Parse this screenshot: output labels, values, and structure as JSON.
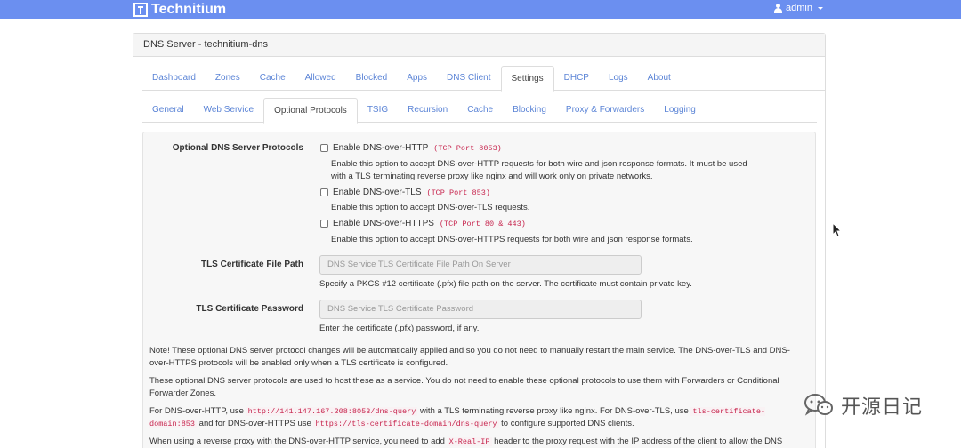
{
  "brand": {
    "name": "Technitium"
  },
  "user": {
    "name": "admin"
  },
  "panel": {
    "title": "DNS Server - technitium-dns"
  },
  "main_tabs": [
    {
      "label": "Dashboard"
    },
    {
      "label": "Zones"
    },
    {
      "label": "Cache"
    },
    {
      "label": "Allowed"
    },
    {
      "label": "Blocked"
    },
    {
      "label": "Apps"
    },
    {
      "label": "DNS Client"
    },
    {
      "label": "Settings"
    },
    {
      "label": "DHCP"
    },
    {
      "label": "Logs"
    },
    {
      "label": "About"
    }
  ],
  "main_tabs_active": "Settings",
  "sub_tabs": [
    {
      "label": "General"
    },
    {
      "label": "Web Service"
    },
    {
      "label": "Optional Protocols"
    },
    {
      "label": "TSIG"
    },
    {
      "label": "Recursion"
    },
    {
      "label": "Cache"
    },
    {
      "label": "Blocking"
    },
    {
      "label": "Proxy & Forwarders"
    },
    {
      "label": "Logging"
    }
  ],
  "sub_tabs_active": "Optional Protocols",
  "protocols": {
    "label": "Optional DNS Server Protocols",
    "http": {
      "label": "Enable DNS-over-HTTP",
      "port": "(TCP Port 8053)",
      "checked": false,
      "help": "Enable this option to accept DNS-over-HTTP requests for both wire and json response formats. It must be used with a TLS terminating reverse proxy like nginx and will work only on private networks."
    },
    "tls": {
      "label": "Enable DNS-over-TLS",
      "port": "(TCP Port 853)",
      "checked": false,
      "help": "Enable this option to accept DNS-over-TLS requests."
    },
    "https": {
      "label": "Enable DNS-over-HTTPS",
      "port": "(TCP Port 80 & 443)",
      "checked": false,
      "help": "Enable this option to accept DNS-over-HTTPS requests for both wire and json response formats."
    }
  },
  "cert_path": {
    "label": "TLS Certificate File Path",
    "placeholder": "DNS Service TLS Certificate File Path On Server",
    "help": "Specify a PKCS #12 certificate (.pfx) file path on the server. The certificate must contain private key."
  },
  "cert_password": {
    "label": "TLS Certificate Password",
    "placeholder": "DNS Service TLS Certificate Password",
    "help": "Enter the certificate (.pfx) password, if any."
  },
  "notes": {
    "note1": "Note! These optional DNS server protocol changes will be automatically applied and so you do not need to manually restart the main service. The DNS-over-TLS and DNS-over-HTTPS protocols will be enabled only when a TLS certificate is configured.",
    "note2": "These optional DNS server protocols are used to host these as a service. You do not need to enable these optional protocols to use them with Forwarders or Conditional Forwarder Zones.",
    "note3_a": "For DNS-over-HTTP, use",
    "note3_code1": "http://141.147.167.208:8053/dns-query",
    "note3_b": "with a TLS terminating reverse proxy like nginx. For DNS-over-TLS, use",
    "note3_code2": "tls-certificate-domain:853",
    "note3_c": "and for DNS-over-HTTPS use",
    "note3_code3": "https://tls-certificate-domain/dns-query",
    "note3_d": "to configure supported DNS clients.",
    "note4_a": "When using a reverse proxy with the DNS-over-HTTP service, you need to add",
    "note4_code": "X-Real-IP",
    "note4_b": "header to the proxy request with the IP address of the client to allow the DNS"
  },
  "watermark": {
    "text": "开源日记"
  }
}
